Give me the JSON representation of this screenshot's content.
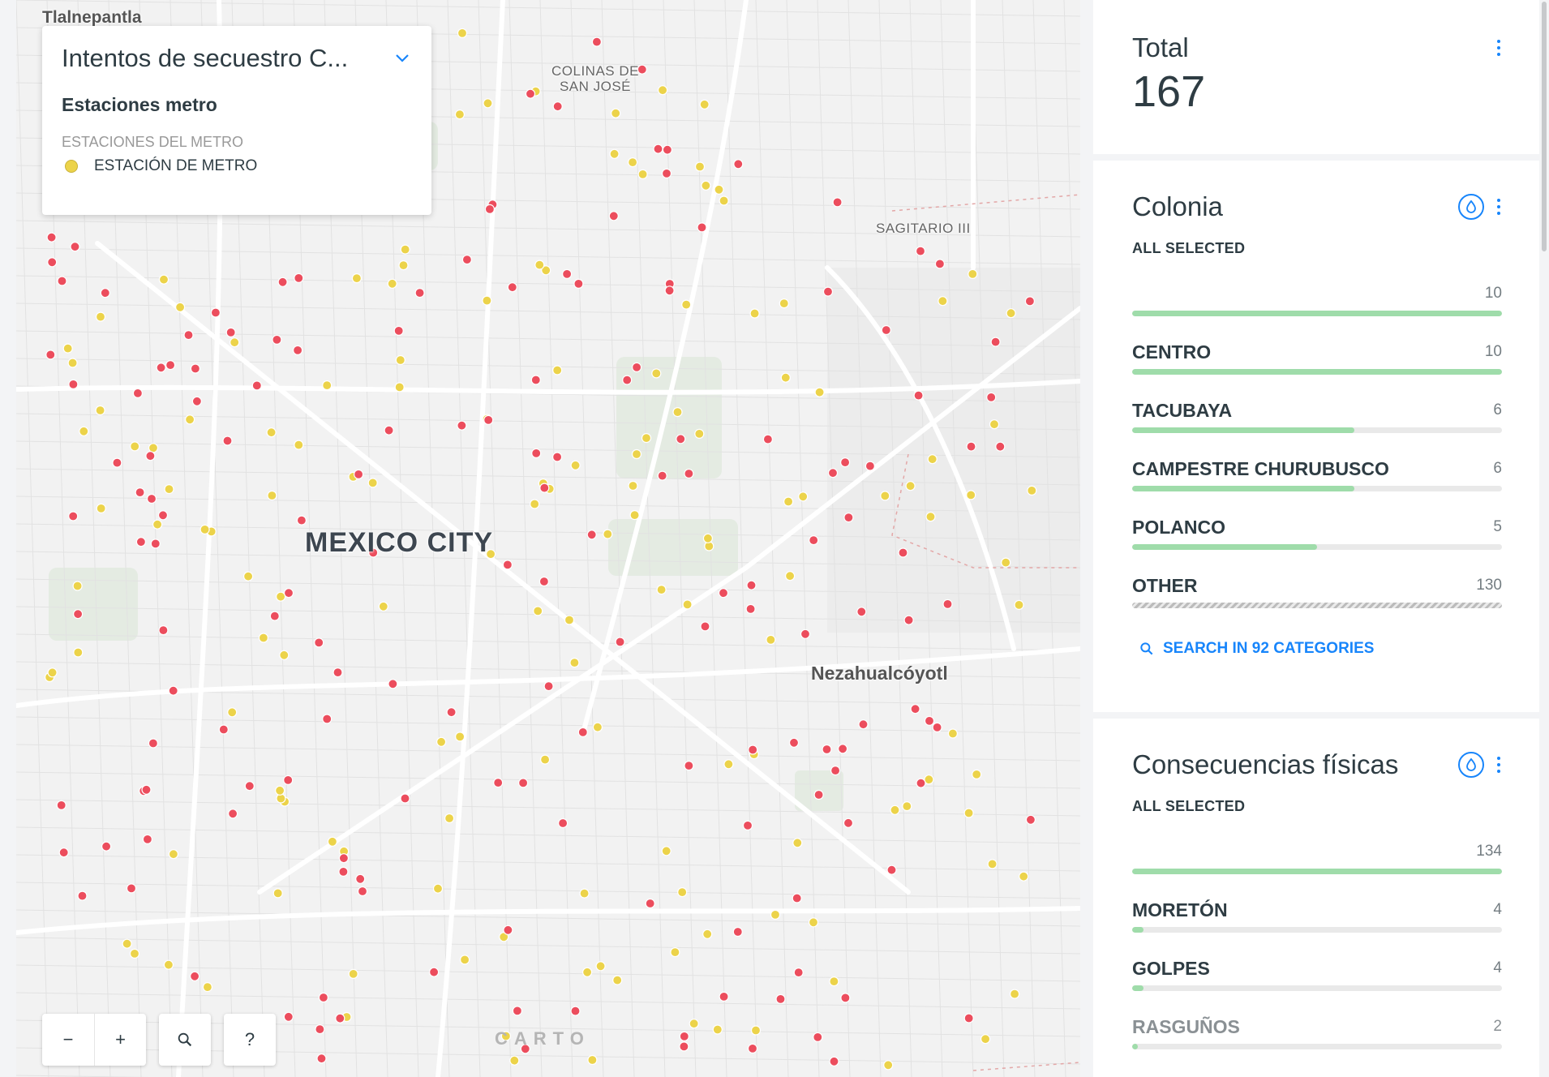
{
  "map": {
    "labels": {
      "tlalnepantla": "Tlalnepantla",
      "colinas": "COLINAS DE\nSAN JOSÉ",
      "sagitario": "SAGITARIO III",
      "city": "MEXICO CITY",
      "neza": "Nezahualcóyotl"
    },
    "legend": {
      "title": "Intentos de secuestro C...",
      "layer_name": "Estaciones metro",
      "subtitle": "ESTACIONES DEL METRO",
      "item_label": "ESTACIÓN DE METRO",
      "item_color": "#ecd34a"
    },
    "controls": {
      "zoom_out": "−",
      "zoom_in": "+",
      "help": "?"
    },
    "attribution": "CARTO",
    "colors": {
      "incident": "#ec4d5d",
      "station": "#ecd34a"
    }
  },
  "widgets": {
    "total": {
      "title": "Total",
      "value": "167"
    },
    "colonia": {
      "title": "Colonia",
      "selection": "ALL SELECTED",
      "max_value": "10",
      "categories": [
        {
          "name": "CENTRO",
          "count": "10",
          "fraction": 1.0
        },
        {
          "name": "TACUBAYA",
          "count": "6",
          "fraction": 0.6
        },
        {
          "name": "CAMPESTRE CHURUBUSCO",
          "count": "6",
          "fraction": 0.6
        },
        {
          "name": "POLANCO",
          "count": "5",
          "fraction": 0.5
        },
        {
          "name": "OTHER",
          "count": "130",
          "fraction": 1.0
        }
      ],
      "search_label": "SEARCH IN 92 CATEGORIES"
    },
    "consecuencias": {
      "title": "Consecuencias físicas",
      "selection": "ALL SELECTED",
      "max_value": "134",
      "categories": [
        {
          "name": "MORETÓN",
          "count": "4",
          "fraction": 0.03
        },
        {
          "name": "GOLPES",
          "count": "4",
          "fraction": 0.03
        },
        {
          "name": "RASGUÑOS",
          "count": "2",
          "fraction": 0.015
        }
      ]
    }
  }
}
